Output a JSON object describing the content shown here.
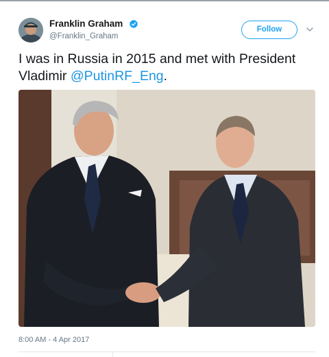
{
  "tweet": {
    "author": {
      "display_name": "Franklin Graham",
      "handle": "@Franklin_Graham",
      "verified": true
    },
    "follow_label": "Follow",
    "text_prefix": "I was in Russia in 2015 and met with President Vladimir ",
    "mention": "@PutinRF_Eng",
    "text_suffix": ".",
    "timestamp": "8:00 AM - 4 Apr 2017"
  },
  "colors": {
    "accent": "#1da1f2",
    "mention": "#1b95e0",
    "secondary_text": "#657786"
  },
  "icons": {
    "verified": "verified-badge-icon",
    "menu": "chevron-down-icon"
  }
}
